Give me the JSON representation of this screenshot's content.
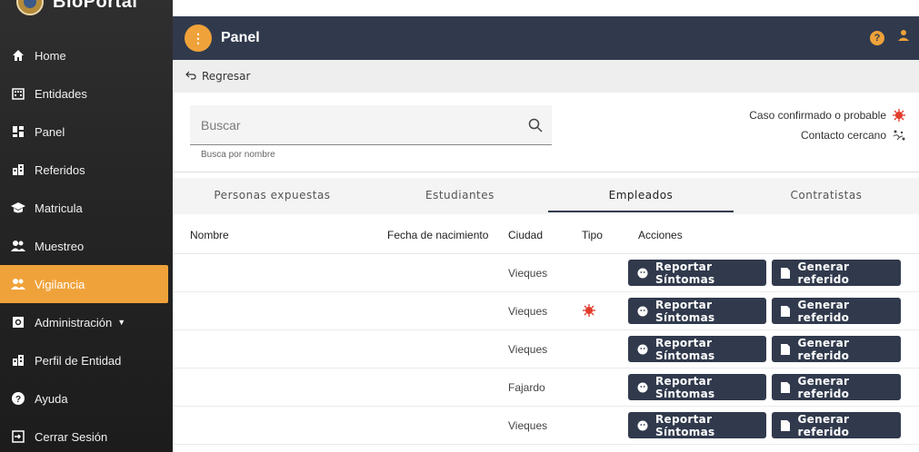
{
  "app": {
    "brand": "BioPortal",
    "header_title": "Panel",
    "menu_glyph": "⋮",
    "help_glyph": "?",
    "accent": "#f0a23a",
    "header_bg": "#313a4d"
  },
  "sidebar": {
    "items": [
      {
        "label": "Home",
        "icon": "home-icon"
      },
      {
        "label": "Entidades",
        "icon": "building-icon"
      },
      {
        "label": "Panel",
        "icon": "dashboard-icon"
      },
      {
        "label": "Referidos",
        "icon": "city-icon"
      },
      {
        "label": "Matricula",
        "icon": "graduation-cap-icon"
      },
      {
        "label": "Muestreo",
        "icon": "people-icon"
      },
      {
        "label": "Vigilancia",
        "icon": "people-icon",
        "active": true
      },
      {
        "label": "Administración",
        "icon": "settings-box-icon",
        "caret": "▼"
      },
      {
        "label": "Perfil de Entidad",
        "icon": "city-icon"
      },
      {
        "label": "Ayuda",
        "icon": "help-icon"
      },
      {
        "label": "Cerrar Sesión",
        "icon": "logout-icon"
      }
    ]
  },
  "backbar": {
    "label": "Regresar"
  },
  "search": {
    "placeholder": "Buscar",
    "helper": "Busca por nombre"
  },
  "legend": {
    "confirmed": "Caso confirmado o probable",
    "contact": "Contacto cercano"
  },
  "tabs": [
    {
      "label": "Personas expuestas"
    },
    {
      "label": "Estudiantes"
    },
    {
      "label": "Empleados",
      "active": true
    },
    {
      "label": "Contratistas"
    }
  ],
  "table": {
    "headers": {
      "nombre": "Nombre",
      "fecha": "Fecha de nacimiento",
      "ciudad": "Ciudad",
      "tipo": "Tipo",
      "acciones": "Acciones"
    },
    "rows": [
      {
        "ciudad": "Vieques",
        "tipo": ""
      },
      {
        "ciudad": "Vieques",
        "tipo": "virus-icon"
      },
      {
        "ciudad": "Vieques",
        "tipo": ""
      },
      {
        "ciudad": "Fajardo",
        "tipo": ""
      },
      {
        "ciudad": "Vieques",
        "tipo": ""
      }
    ],
    "btn_report": "Reportar Síntomas",
    "btn_refer": "Generar referido"
  }
}
